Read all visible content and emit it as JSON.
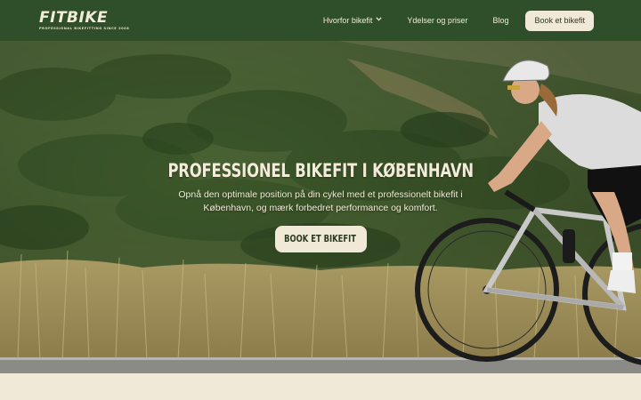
{
  "brand": {
    "name": "FITBIKE",
    "tagline": "Professional bikefitting since 2008"
  },
  "nav": {
    "items": [
      {
        "label": "Hvorfor bikefit",
        "has_dropdown": true
      },
      {
        "label": "Ydelser og priser"
      },
      {
        "label": "Blog"
      }
    ],
    "cta_label": "Book et bikefit"
  },
  "hero": {
    "title": "Professionel bikefit i København",
    "subtitle": "Opnå den optimale position på din cykel med et professionelt bikefit i København, og mærk forbedret performance og komfort.",
    "button_label": "Book et bikefit",
    "image": "cyclist-road-bike-hillside"
  },
  "colors": {
    "header_bg": "#2f4f2b",
    "cream": "#f1e9d8",
    "text_dark": "#2a3a22"
  }
}
